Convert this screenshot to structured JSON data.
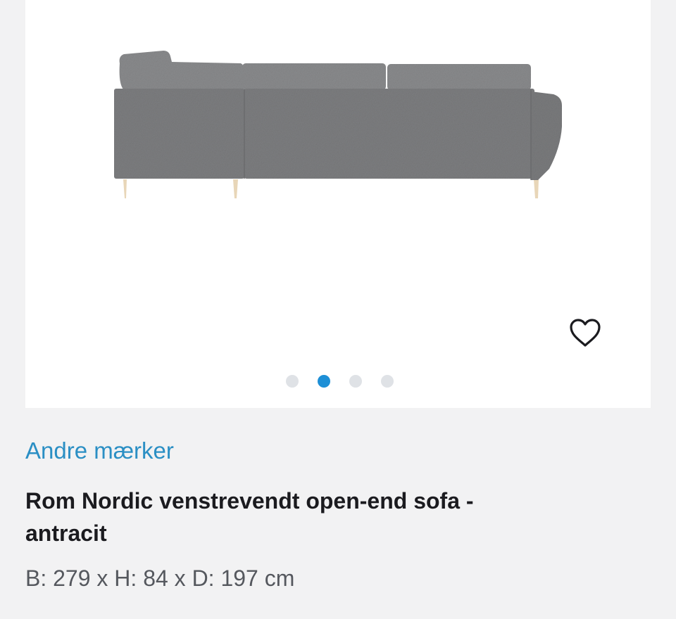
{
  "product": {
    "brand_link": "Andre mærker",
    "title": "Rom Nordic venstrevendt open-end sofa - antracit",
    "dimensions": "B: 279 x H: 84 x D: 197 cm"
  },
  "gallery": {
    "image_count": 4,
    "active_index": 1,
    "favorite_icon": "heart-outline-icon"
  },
  "colors": {
    "background": "#f2f2f3",
    "brand_link": "#2b8fc4",
    "active_dot": "#1d8fd6",
    "inactive_dot": "#dfe2e6",
    "sofa_fabric": "#7d7e80"
  }
}
